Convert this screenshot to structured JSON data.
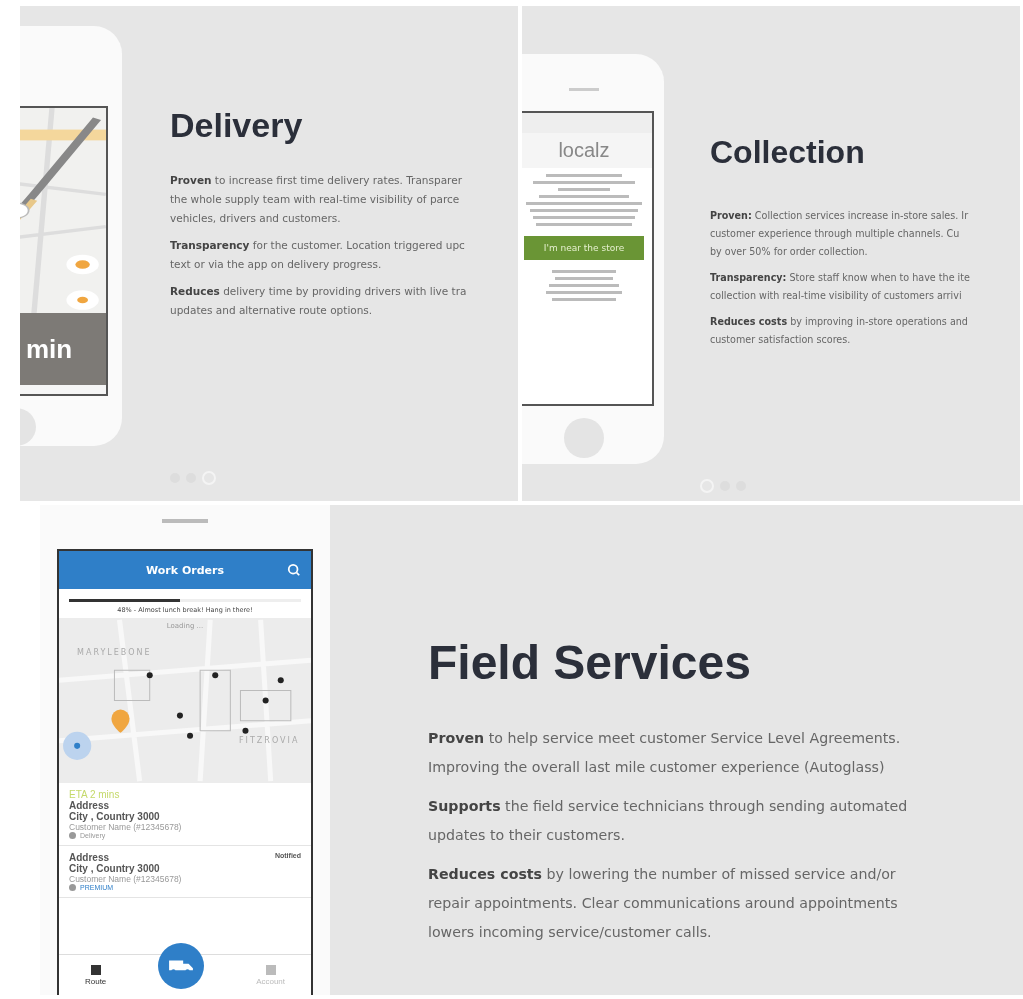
{
  "panels": [
    {
      "kind": "delivery",
      "title": "Delivery",
      "paragraphs": [
        [
          "**Proven** to increase first time delivery rates. Transparer",
          "the whole supply team with real-time visibility of parce",
          "vehicles, drivers and customers."
        ],
        [
          "**Transparency** for the customer. Location triggered upc",
          "text or via the app on delivery progress."
        ],
        [
          "**Reduces** delivery time by providing drivers with live tra",
          "updates and alternative route options."
        ]
      ],
      "dots": [
        {
          "selected": false
        },
        {
          "selected": false
        },
        {
          "selected": true
        }
      ],
      "phone": {
        "eta": "min"
      }
    },
    {
      "kind": "collection",
      "title": "Collection",
      "paragraphs": [
        [
          "**Proven:** Collection services increase in-store sales. Ir",
          "customer experience through multiple channels. Cu",
          "by over 50% for order collection."
        ],
        [
          "**Transparency:** Store staff know when to have the ite",
          "collection with real-time visibility of customers arrivi"
        ],
        [
          "**Reduces costs** by improving in-store operations and",
          "customer satisfaction scores."
        ]
      ],
      "dots": [
        {
          "selected": true
        },
        {
          "selected": false
        },
        {
          "selected": false
        }
      ],
      "phone": {
        "logo": "localz",
        "button": "I'm near the store"
      }
    },
    {
      "kind": "field",
      "title": "Field Services",
      "paragraphs": [
        [
          "**Proven** to help service meet customer Service Level Agreements.",
          "Improving the overall last mile customer experience (Autoglass)"
        ],
        [
          "**Supports** the field service technicians through sending automated",
          "updates to their customers."
        ],
        [
          "**Reduces costs** by lowering the number of missed service and/or",
          "repair appointments. Clear communications around appointments",
          "lowers incoming service/customer calls."
        ]
      ],
      "phone": {
        "header": "Work Orders",
        "progress": {
          "level": 0.48,
          "text": "48% - Almost lunch break! Hang in there!"
        },
        "loading": "Loading ...",
        "areas": [
          "MARYLEBONE",
          "FITZROVIA"
        ],
        "eta": "ETA 2 mins",
        "orders": [
          {
            "address": "Address",
            "city": "City , Country 3000",
            "customer": "Customer Name (#12345678)",
            "tag": "Delivery"
          },
          {
            "address": "Address",
            "city": "City , Country 3000",
            "customer": "Customer Name (#12345678)",
            "status": "Notified",
            "tag": "PREMIUM"
          }
        ],
        "tabs": [
          {
            "label": "Route",
            "selected": true
          },
          {
            "label": "Account",
            "selected": false
          }
        ]
      }
    }
  ]
}
